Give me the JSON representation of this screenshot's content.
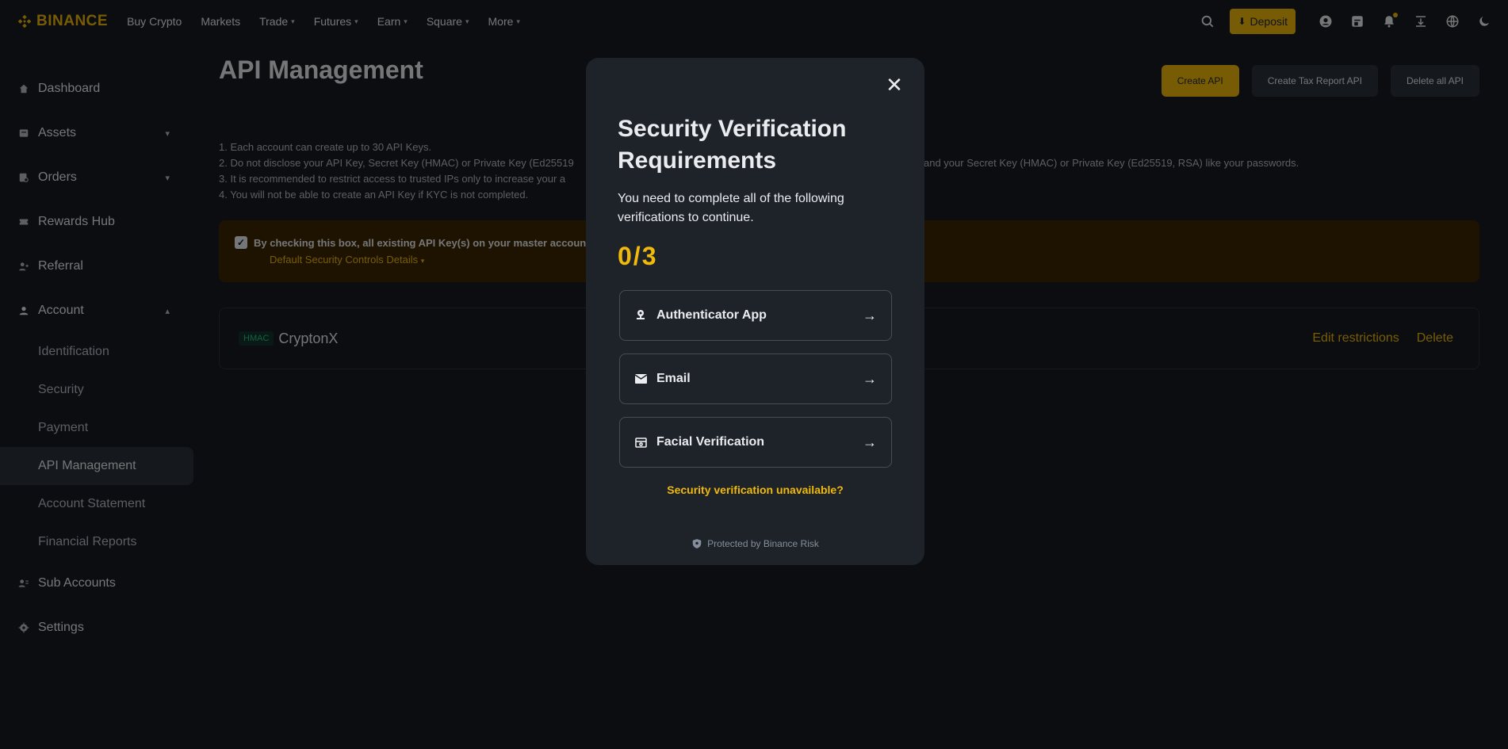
{
  "topnav": {
    "brand": "BINANCE",
    "items": [
      {
        "label": "Buy Crypto",
        "has_dropdown": false
      },
      {
        "label": "Markets",
        "has_dropdown": false
      },
      {
        "label": "Trade",
        "has_dropdown": true
      },
      {
        "label": "Futures",
        "has_dropdown": true
      },
      {
        "label": "Earn",
        "has_dropdown": true
      },
      {
        "label": "Square",
        "has_dropdown": true
      },
      {
        "label": "More",
        "has_dropdown": true
      }
    ],
    "deposit_label": "Deposit",
    "icons": [
      "search-icon",
      "user-icon",
      "orders-icon",
      "bell-icon",
      "download-icon",
      "globe-icon",
      "moon-icon"
    ]
  },
  "sidebar": {
    "items": [
      {
        "label": "Dashboard",
        "icon": "home-icon"
      },
      {
        "label": "Assets",
        "icon": "wallet-icon",
        "expandable": true
      },
      {
        "label": "Orders",
        "icon": "orders-icon",
        "expandable": true
      },
      {
        "label": "Rewards Hub",
        "icon": "ticket-icon"
      },
      {
        "label": "Referral",
        "icon": "user-plus-icon"
      },
      {
        "label": "Account",
        "icon": "user-icon",
        "expanded": true
      }
    ],
    "account_sub": [
      "Identification",
      "Security",
      "Payment",
      "API Management",
      "Account Statement",
      "Financial Reports"
    ],
    "active_sub": "API Management",
    "bottom_items": [
      {
        "label": "Sub Accounts",
        "icon": "users-icon"
      },
      {
        "label": "Settings",
        "icon": "gear-icon"
      }
    ]
  },
  "main": {
    "title": "API Management",
    "buttons": {
      "create_api": "Create API",
      "create_tax": "Create Tax Report API",
      "delete_all": "Delete all API"
    },
    "notes": [
      "1. Each account can create up to 30 API Keys.",
      "2. Do not disclose your API Key, Secret Key (HMAC) or Private Key (Ed25519",
      "3. It is recommended to restrict access to trusted IPs only to increase your a",
      "4. You will not be able to create an API Key if KYC is not completed."
    ],
    "note2_tail": "and your Secret Key (HMAC) or Private Key (Ed25519, RSA) like your passwords.",
    "warning": {
      "text": "By checking this box, all existing API Key(s) on your master account",
      "link": "Default Security Controls Details"
    },
    "api_key": {
      "type": "HMAC",
      "name": "CryptonX",
      "edit": "Edit restrictions",
      "delete": "Delete"
    }
  },
  "modal": {
    "title": "Security Verification Requirements",
    "subtitle": "You need to complete all of the following verifications to continue.",
    "progress": "0/3",
    "options": [
      {
        "label": "Authenticator App",
        "icon": "authenticator-icon"
      },
      {
        "label": "Email",
        "icon": "mail-icon"
      },
      {
        "label": "Facial Verification",
        "icon": "face-icon"
      }
    ],
    "unavailable_link": "Security verification unavailable?",
    "footer": "Protected by Binance Risk"
  },
  "colors": {
    "accent": "#f0b90b",
    "background": "#181a20",
    "modal_bg": "#1e2329"
  }
}
